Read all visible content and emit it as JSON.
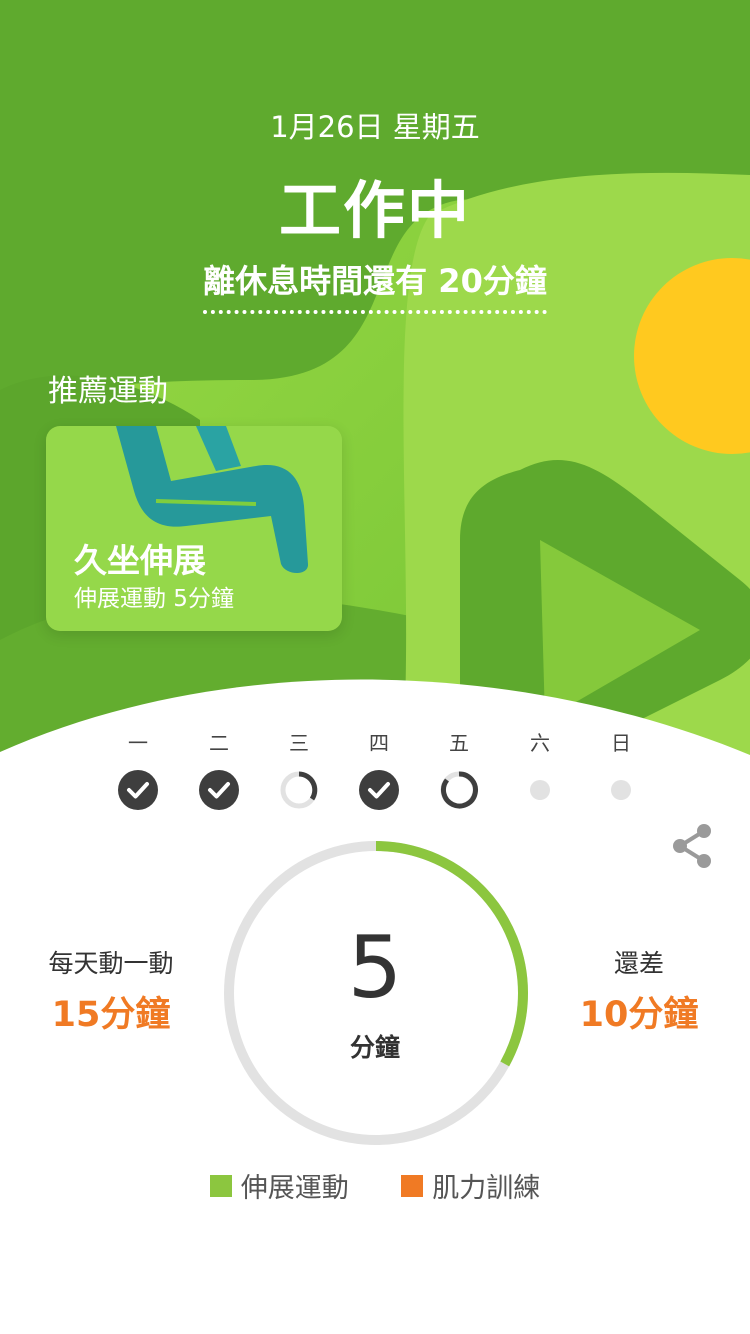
{
  "header": {
    "date": "1月26日 星期五",
    "status": "工作中",
    "countdown": "離休息時間還有 20分鐘"
  },
  "recommend": {
    "title": "推薦運動",
    "card": {
      "name": "久坐伸展",
      "desc": "伸展運動 5分鐘"
    }
  },
  "week": [
    {
      "label": "一",
      "state": "done"
    },
    {
      "label": "二",
      "state": "done"
    },
    {
      "label": "三",
      "state": "partial"
    },
    {
      "label": "四",
      "state": "done"
    },
    {
      "label": "五",
      "state": "today"
    },
    {
      "label": "六",
      "state": "empty"
    },
    {
      "label": "日",
      "state": "empty"
    }
  ],
  "progress": {
    "value": "5",
    "unit": "分鐘",
    "fraction": 0.33,
    "goal_label": "每天動一動",
    "goal_value": "15分鐘",
    "remain_label": "還差",
    "remain_value": "10分鐘"
  },
  "legend": [
    {
      "label": "伸展運動",
      "color": "#8cc63f"
    },
    {
      "label": "肌力訓練",
      "color": "#f07a24"
    }
  ],
  "icons": {
    "share": "share-icon",
    "check": "check-icon"
  },
  "colors": {
    "brand_green": "#8cc63f",
    "accent_orange": "#f07a24",
    "sun_yellow": "#ffc91f",
    "figure_teal": "#26999a"
  }
}
